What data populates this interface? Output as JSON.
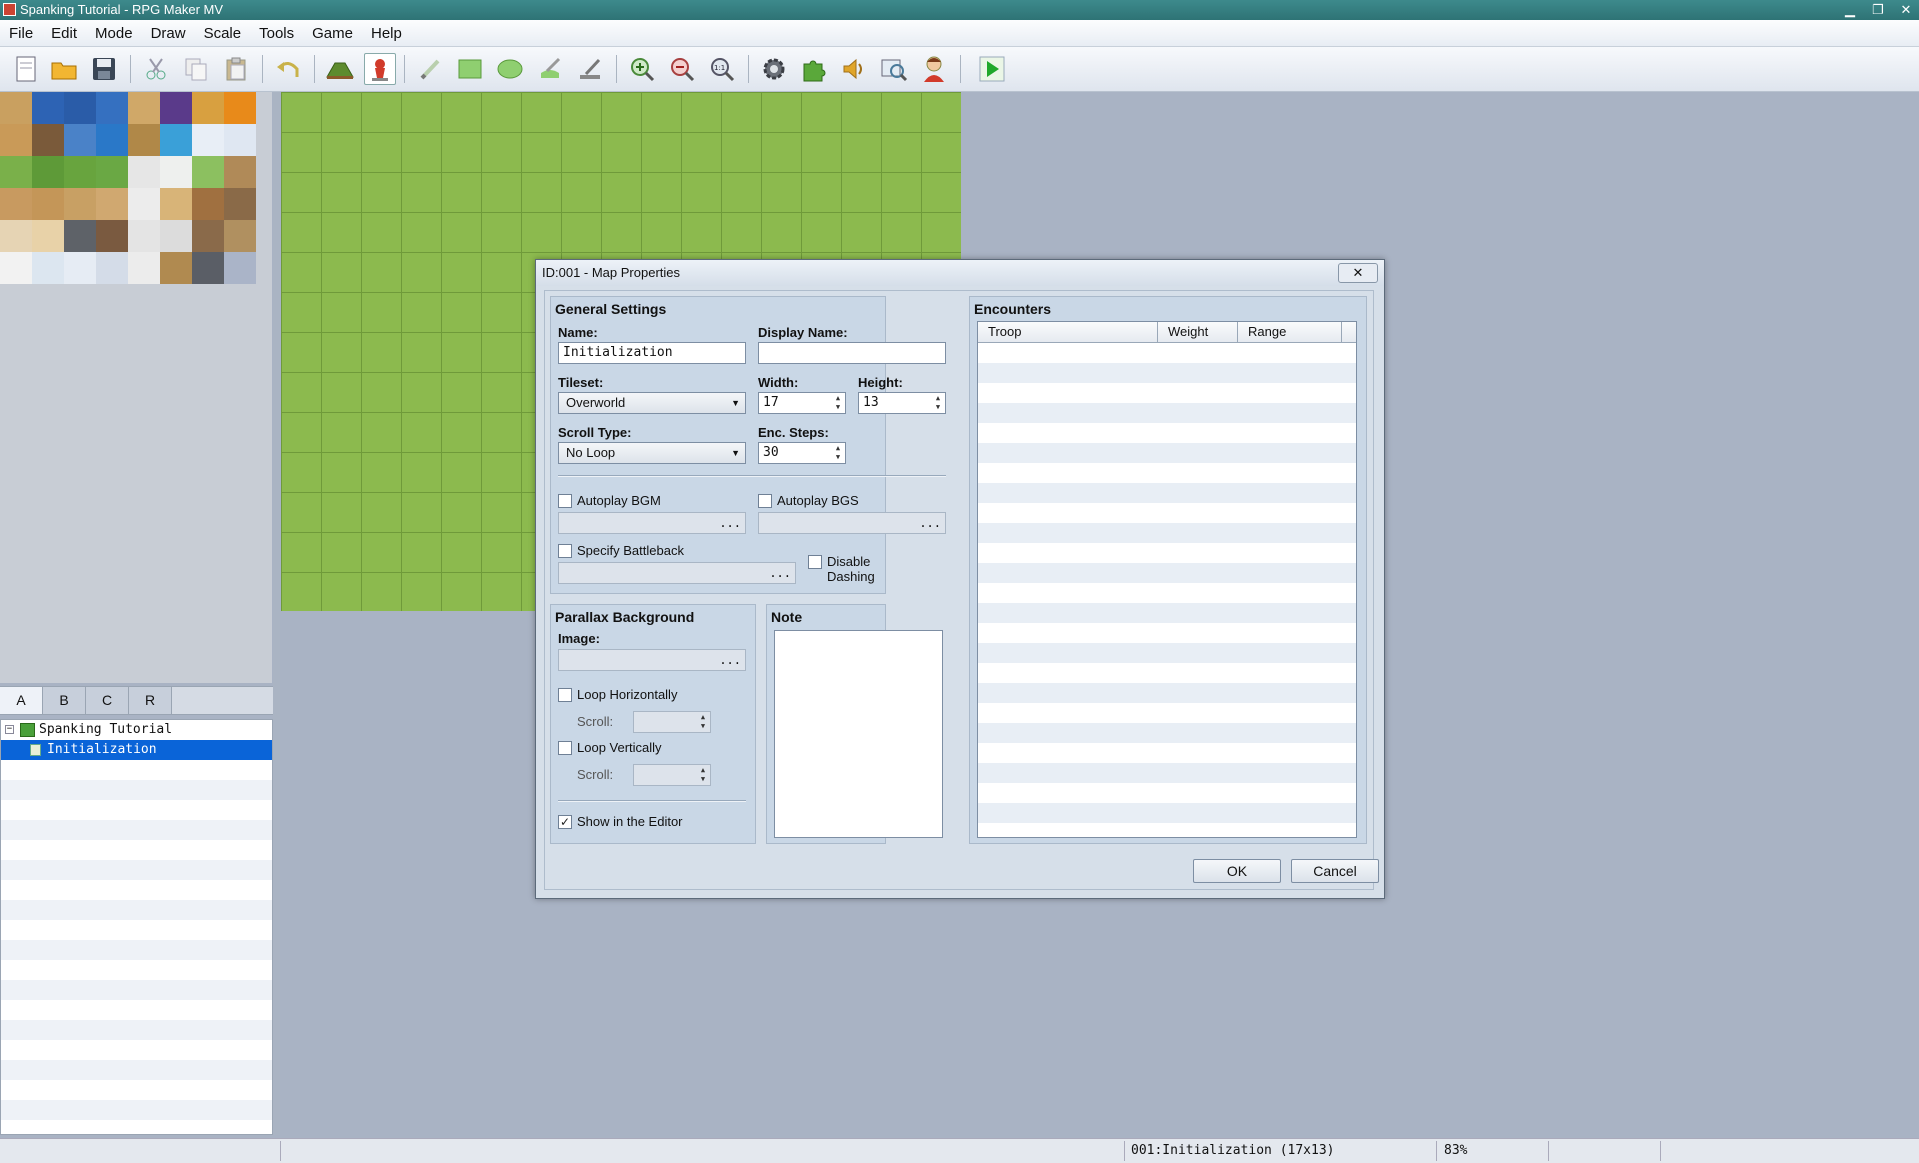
{
  "window": {
    "title": "Spanking Tutorial - RPG Maker MV"
  },
  "menu": [
    "File",
    "Edit",
    "Mode",
    "Draw",
    "Scale",
    "Tools",
    "Game",
    "Help"
  ],
  "toolbar": {
    "buttons": [
      "new-project-icon",
      "open-project-icon",
      "save-project-icon",
      "cut-icon",
      "copy-icon",
      "paste-icon",
      "undo-icon",
      "map-mode-icon",
      "event-mode-icon",
      "pencil-icon",
      "rectangle-icon",
      "ellipse-icon",
      "flood-fill-icon",
      "shadow-pen-icon",
      "zoom-in-icon",
      "zoom-out-icon",
      "actual-size-icon",
      "database-icon",
      "plugin-manager-icon",
      "sound-test-icon",
      "event-searcher-icon",
      "character-generator-icon",
      "playtest-icon"
    ]
  },
  "tileset_tabs": [
    "A",
    "B",
    "C",
    "R"
  ],
  "map_tree": {
    "project": "Spanking Tutorial",
    "maps": [
      "Initialization"
    ]
  },
  "dialog": {
    "title": "ID:001 - Map Properties",
    "close": "✕",
    "general": {
      "heading": "General Settings",
      "name_label": "Name:",
      "name_value": "Initialization",
      "display_name_label": "Display Name:",
      "display_name_value": "",
      "tileset_label": "Tileset:",
      "tileset_value": "Overworld",
      "width_label": "Width:",
      "width_value": "17",
      "height_label": "Height:",
      "height_value": "13",
      "scroll_type_label": "Scroll Type:",
      "scroll_type_value": "No Loop",
      "enc_steps_label": "Enc. Steps:",
      "enc_steps_value": "30",
      "autoplay_bgm": "Autoplay BGM",
      "autoplay_bgs": "Autoplay BGS",
      "specify_battleback": "Specify Battleback",
      "disable_dashing": "Disable Dashing",
      "dots": "..."
    },
    "parallax": {
      "heading": "Parallax Background",
      "image_label": "Image:",
      "loop_h": "Loop Horizontally",
      "loop_v": "Loop Vertically",
      "scroll_label": "Scroll:",
      "show_in_editor": "Show in the Editor",
      "show_checked": "✓"
    },
    "note": {
      "heading": "Note"
    },
    "encounters": {
      "heading": "Encounters",
      "columns": [
        "Troop",
        "Weight",
        "Range"
      ]
    },
    "ok": "OK",
    "cancel": "Cancel"
  },
  "status": {
    "map_info": "001:Initialization (17x13)",
    "zoom": "83%"
  },
  "colors": {
    "grass": "#8cba4e",
    "selection": "#0a64d8",
    "panel": "#c9d7e6"
  }
}
